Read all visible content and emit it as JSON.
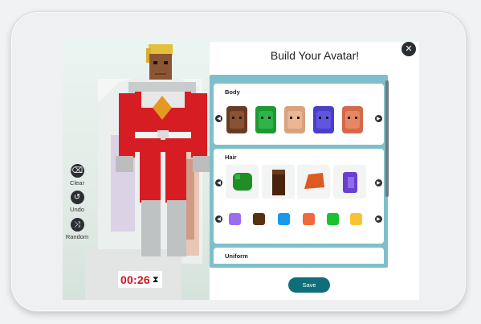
{
  "tools": [
    {
      "id": "clear",
      "label": "Clear",
      "icon": "eraser-icon",
      "glyph": "⌫"
    },
    {
      "id": "undo",
      "label": "Undo",
      "icon": "undo-icon",
      "glyph": "↺"
    },
    {
      "id": "random",
      "label": "Random",
      "icon": "shuffle-icon",
      "glyph": "⤨"
    }
  ],
  "timer": {
    "value": "00:26",
    "icon": "hourglass-icon",
    "glyph": "⧗"
  },
  "panel": {
    "title": "Build Your Avatar!",
    "close_glyph": "✕",
    "save_label": "Save",
    "sections": {
      "body": {
        "title": "Body",
        "options": [
          {
            "color": "#6a3b23",
            "face": "#8a5232"
          },
          {
            "color": "#1e9a33",
            "face": "#2fb44a"
          },
          {
            "color": "#d9a27e",
            "face": "#eab693"
          },
          {
            "color": "#4a3fc9",
            "face": "#5f55e0"
          },
          {
            "color": "#d36a4a",
            "face": "#e88563"
          }
        ]
      },
      "hair": {
        "title": "Hair",
        "styles": [
          {
            "color": "#1f8e24"
          },
          {
            "color": "#4b2410"
          },
          {
            "color": "#dd5a22"
          },
          {
            "color": "#6a3fd1"
          }
        ],
        "colors": [
          "#9a6df0",
          "#5b2f12",
          "#1897ee",
          "#f0683c",
          "#1ac230",
          "#f7c531"
        ]
      },
      "uniform": {
        "title": "Uniform"
      }
    }
  },
  "colors": {
    "accent": "#0f6e79",
    "frame": "#7fbfcb",
    "timer": "#d4111b"
  }
}
